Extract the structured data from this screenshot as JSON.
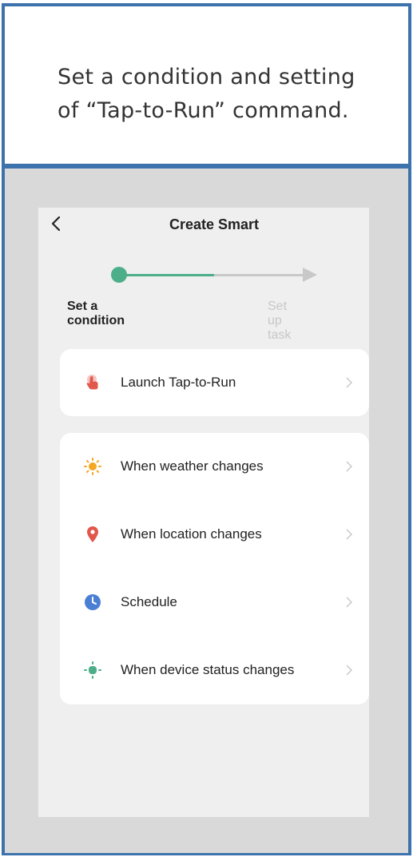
{
  "caption": {
    "line1": "Set a condition and setting",
    "line2": "of “Tap-to-Run” command."
  },
  "header": {
    "title": "Create Smart",
    "back_icon": "chevron-left-icon"
  },
  "steps": {
    "current": "Set a condition",
    "next": "Set up task",
    "colors": {
      "active": "#4caf89",
      "inactive": "#c8c8c8"
    }
  },
  "primary_option": {
    "label": "Launch Tap-to-Run",
    "icon": "tap-hand-icon",
    "color": "#e2574c"
  },
  "conditions": [
    {
      "label": "When weather changes",
      "icon": "sun-icon",
      "color": "#f5a623"
    },
    {
      "label": "When location changes",
      "icon": "location-pin-icon",
      "color": "#e2574c"
    },
    {
      "label": "Schedule",
      "icon": "clock-icon",
      "color": "#4a7fd4"
    },
    {
      "label": "When device status changes",
      "icon": "device-status-icon",
      "color": "#4caf89"
    }
  ],
  "colors": {
    "frame_border": "#3d73ac",
    "screen_bg": "#efefef",
    "card_bg": "#ffffff"
  }
}
